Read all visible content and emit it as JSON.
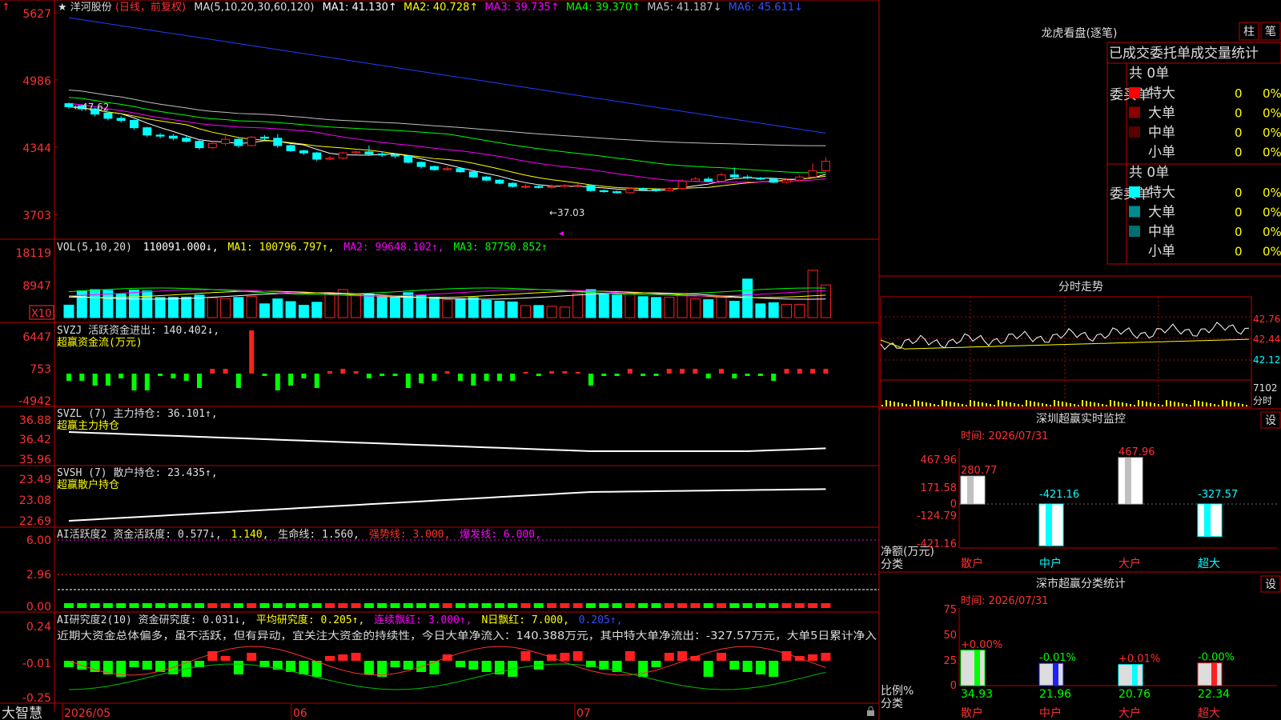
{
  "app": {
    "brand": "大智慧"
  },
  "price_panel": {
    "title_star": "★",
    "stock_name": "洋河股份",
    "mode": "(日线，前复权)",
    "ma_label": "MA(5,10,20,30,60,120)",
    "ma1": "MA1: 41.130↑",
    "ma2": "MA2: 40.728↑",
    "ma3": "MA3: 39.735↑",
    "ma4": "MA4: 39.370↑",
    "ma5": "MA5: 41.187↓",
    "ma6": "MA6: 45.611↓",
    "y_ticks": [
      "5627",
      "4986",
      "4344",
      "3703"
    ],
    "high_mark": "←47.62",
    "low_mark": "←37.03"
  },
  "vol_panel": {
    "label": "VOL(5,10,20)",
    "value": "110091.000↓,",
    "ma1": "MA1: 100796.797↑,",
    "ma2": "MA2: 99648.102↑,",
    "ma3": "MA3: 87750.852↑",
    "y_ticks": [
      "18119",
      "8947"
    ],
    "unit_badge": "X10"
  },
  "svzj_panel": {
    "label": "SVZJ  活跃资金进出: 140.402↓,",
    "sub": "超赢资金流(万元)",
    "y_ticks": [
      "6447",
      "753",
      "-4942"
    ]
  },
  "svzl_panel": {
    "label": "SVZL (7) 主力持仓: 36.101↑,",
    "sub": "超赢主力持仓",
    "y_ticks": [
      "36.88",
      "36.42",
      "35.96"
    ]
  },
  "svsh_panel": {
    "label": "SVSH (7) 散户持仓: 23.435↑,",
    "sub": "超赢散户持仓",
    "y_ticks": [
      "23.49",
      "23.08",
      "22.69"
    ]
  },
  "ai1_panel": {
    "label": "AI活跃度2 资金活跃度: 0.577↓,",
    "v2": "1.140,",
    "life": "生命线: 1.560,",
    "strong": "强势线: 3.000,",
    "burst": "爆发线: 6.000,",
    "y_ticks": [
      "6.00",
      "2.96",
      "0.00"
    ]
  },
  "ai2_panel": {
    "label": "AI研究度2(10) 资金研究度: 0.031↓,",
    "avg": "平均研究度: 0.205↑,",
    "streak_red": "连续飘红: 3.000↑,",
    "n_red": "N日飘红: 7.000,",
    "tail": "0.205↑,",
    "comment": "近期大资金总体偏多，虽不活跃，但有异动，宜关注大资金的持续性，今日大单净流入：140.388万元，其中特大单净流出：-327.57万元，大单5日累计净入",
    "y_ticks": [
      "0.24",
      "-0.01",
      "-0.25"
    ]
  },
  "x_axis": {
    "labels": [
      "2026/05",
      "06",
      "07"
    ]
  },
  "longhu": {
    "title": "龙虎看盘(逐笔)",
    "btn_zhu": "柱",
    "btn_bi": "笔",
    "subtitle": "已成交委托单成交量统计",
    "buy_label": "委买单",
    "sell_label": "委卖单",
    "buy_total": "共 0单",
    "sell_total": "共 0单",
    "buy_rows": [
      {
        "name": "特大",
        "count": "0",
        "pct": "0%",
        "color": "#ff0000"
      },
      {
        "name": "大单",
        "count": "0",
        "pct": "0%",
        "color": "#8b0000"
      },
      {
        "name": "中单",
        "count": "0",
        "pct": "0%",
        "color": "#5a0000"
      },
      {
        "name": "小单",
        "count": "0",
        "pct": "0%",
        "color": ""
      }
    ],
    "sell_rows": [
      {
        "name": "特大",
        "count": "0",
        "pct": "0%",
        "color": "#00ffff"
      },
      {
        "name": "大单",
        "count": "0",
        "pct": "0%",
        "color": "#008b8b"
      },
      {
        "name": "中单",
        "count": "0",
        "pct": "0%",
        "color": "#006f6f"
      },
      {
        "name": "小单",
        "count": "0",
        "pct": "0%",
        "color": ""
      }
    ]
  },
  "intraday": {
    "title": "分时走势",
    "prices": [
      "42.76",
      "42.44",
      "42.12"
    ],
    "vol_label": "7102",
    "vol_unit": "分时"
  },
  "sz_monitor": {
    "title": "深圳超赢实时监控",
    "settings": "设",
    "time": "时间: 2026/07/31",
    "y_ticks": [
      "467.96",
      "171.58",
      "0",
      "-124.79",
      "-421.16"
    ],
    "ylabel": "净额(万元)",
    "xlabel": "分类",
    "bars": [
      {
        "name": "散户",
        "value": 280.77,
        "label": "280.77"
      },
      {
        "name": "中户",
        "value": -421.16,
        "label": "-421.16"
      },
      {
        "name": "大户",
        "value": 467.96,
        "label": "467.96"
      },
      {
        "name": "超大",
        "value": -327.57,
        "label": "-327.57"
      }
    ]
  },
  "sz_class": {
    "title": "深市超赢分类统计",
    "settings": "设",
    "time": "时间: 2026/07/31",
    "y_ticks": [
      "75",
      "50",
      "25",
      "0"
    ],
    "ylabel": "比例%",
    "xlabel": "分类",
    "bars": [
      {
        "name": "散户",
        "value": 34.93,
        "delta": "+0.00%"
      },
      {
        "name": "中户",
        "value": 21.96,
        "delta": "-0.01%"
      },
      {
        "name": "大户",
        "value": 20.76,
        "delta": "+0.01%"
      },
      {
        "name": "超大",
        "value": 22.34,
        "delta": "-0.00%"
      }
    ]
  },
  "colors": {
    "frame": "#c00000",
    "up": "#ff2020",
    "down": "#00ffff",
    "ma1": "#ffffff",
    "ma2": "#ffff00",
    "ma3": "#ff00ff",
    "ma4": "#00ff00",
    "ma5": "#c0c0c0",
    "ma6": "#2040ff"
  },
  "chart_data": {
    "type": "candlestick",
    "title": "洋河股份",
    "ylim": [
      37.03,
      56.27
    ],
    "candles": [
      [
        47.6,
        47.3,
        47.7,
        47.1
      ],
      [
        47.4,
        47.1,
        47.5,
        46.9
      ],
      [
        47.1,
        46.6,
        47.2,
        46.4
      ],
      [
        46.7,
        46.2,
        46.8,
        46.0
      ],
      [
        46.2,
        46.0,
        46.4,
        45.8
      ],
      [
        46.0,
        45.3,
        46.1,
        45.1
      ],
      [
        45.3,
        44.6,
        45.4,
        44.4
      ],
      [
        44.6,
        44.5,
        44.8,
        44.3
      ],
      [
        44.5,
        44.3,
        44.7,
        44.1
      ],
      [
        44.3,
        44.0,
        44.5,
        43.9
      ],
      [
        44.0,
        43.4,
        44.2,
        43.2
      ],
      [
        43.4,
        43.8,
        44.0,
        43.3
      ],
      [
        43.8,
        44.2,
        44.5,
        43.6
      ],
      [
        44.2,
        43.6,
        44.3,
        43.4
      ],
      [
        43.6,
        44.4,
        44.5,
        43.5
      ],
      [
        44.4,
        44.3,
        44.6,
        44.1
      ],
      [
        44.3,
        43.6,
        44.7,
        43.4
      ],
      [
        43.6,
        43.1,
        43.7,
        43.0
      ],
      [
        43.1,
        42.9,
        43.2,
        42.7
      ],
      [
        42.9,
        42.3,
        43.0,
        42.1
      ],
      [
        42.3,
        42.4,
        42.6,
        42.2
      ],
      [
        42.4,
        42.9,
        43.0,
        42.3
      ],
      [
        42.9,
        43.0,
        43.1,
        42.8
      ],
      [
        43.0,
        42.8,
        43.6,
        42.7
      ],
      [
        42.8,
        42.7,
        43.0,
        42.5
      ],
      [
        42.7,
        42.6,
        42.8,
        42.4
      ],
      [
        42.6,
        42.0,
        42.7,
        41.9
      ],
      [
        42.0,
        41.6,
        42.1,
        41.4
      ],
      [
        41.6,
        41.3,
        41.7,
        41.2
      ],
      [
        41.3,
        41.4,
        41.6,
        41.2
      ],
      [
        41.4,
        41.1,
        41.5,
        41.0
      ],
      [
        41.1,
        40.6,
        41.2,
        40.5
      ],
      [
        40.6,
        40.3,
        40.7,
        40.2
      ],
      [
        40.3,
        40.0,
        40.4,
        39.9
      ],
      [
        40.0,
        39.7,
        40.1,
        39.6
      ],
      [
        39.7,
        39.7,
        39.9,
        39.5
      ],
      [
        39.7,
        39.6,
        39.8,
        39.5
      ],
      [
        39.6,
        39.7,
        39.9,
        39.5
      ],
      [
        39.7,
        39.8,
        39.9,
        39.6
      ],
      [
        39.8,
        39.8,
        40.0,
        39.6
      ],
      [
        39.8,
        39.3,
        39.9,
        39.2
      ],
      [
        39.3,
        39.2,
        39.4,
        39.1
      ],
      [
        39.2,
        39.1,
        39.3,
        39.0
      ],
      [
        39.1,
        39.5,
        39.6,
        39.0
      ],
      [
        39.5,
        39.4,
        39.6,
        39.3
      ],
      [
        39.4,
        39.3,
        39.5,
        39.2
      ],
      [
        39.3,
        39.5,
        39.6,
        39.2
      ],
      [
        39.5,
        40.2,
        40.4,
        39.4
      ],
      [
        40.2,
        40.4,
        40.6,
        40.1
      ],
      [
        40.4,
        40.2,
        40.6,
        40.1
      ],
      [
        40.2,
        40.8,
        41.0,
        40.1
      ],
      [
        40.8,
        40.6,
        41.5,
        40.5
      ],
      [
        40.6,
        40.5,
        40.8,
        40.4
      ],
      [
        40.5,
        40.4,
        40.6,
        40.3
      ],
      [
        40.4,
        40.1,
        40.5,
        40.0
      ],
      [
        40.1,
        40.3,
        40.5,
        40.0
      ],
      [
        40.3,
        40.6,
        40.8,
        40.2
      ],
      [
        40.6,
        41.2,
        41.9,
        40.5
      ],
      [
        41.2,
        42.1,
        42.5,
        41.1
      ]
    ]
  }
}
